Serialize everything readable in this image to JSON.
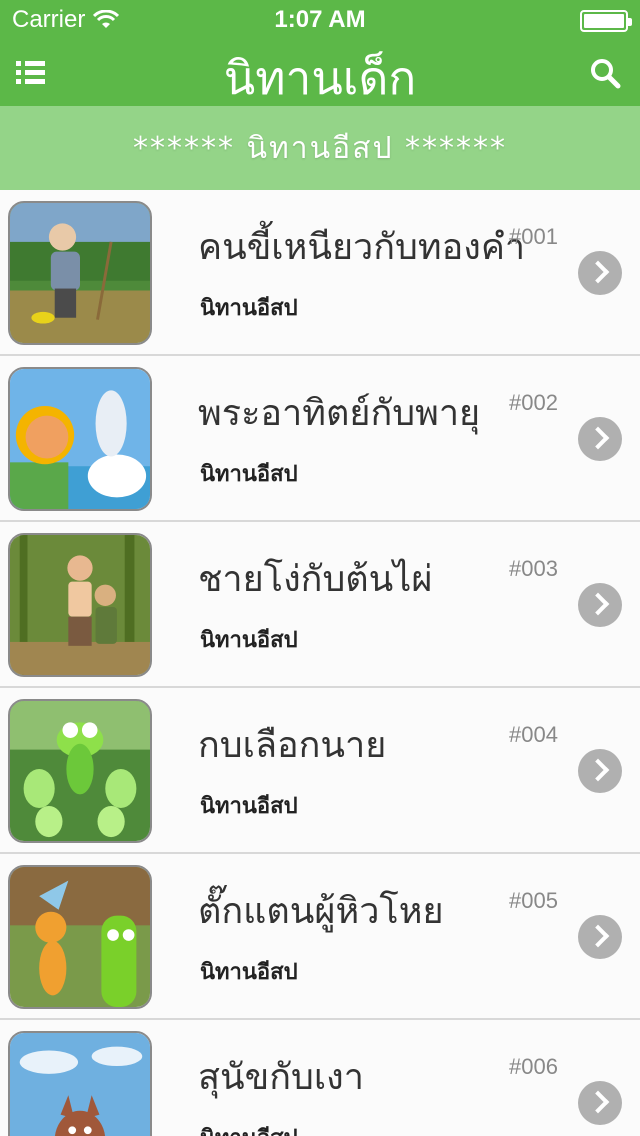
{
  "status_bar": {
    "carrier": "Carrier",
    "time": "1:07 AM"
  },
  "nav": {
    "title": "นิทานเด็ก",
    "menu_icon": "list-icon",
    "search_icon": "search-icon",
    "color": "#5cb848"
  },
  "section": {
    "header": "******   นิทานอีสป   ******",
    "color": "#94d488"
  },
  "items": [
    {
      "title": "คนขี้เหนียวกับทองคำ",
      "number": "#001",
      "category": "นิทานอีสป"
    },
    {
      "title": "พระอาทิตย์กับพายุ",
      "number": "#002",
      "category": "นิทานอีสป"
    },
    {
      "title": "ชายโง่กับต้นไผ่",
      "number": "#003",
      "category": "นิทานอีสป"
    },
    {
      "title": "กบเลือกนาย",
      "number": "#004",
      "category": "นิทานอีสป"
    },
    {
      "title": "ตั๊กแตนผู้หิวโหย",
      "number": "#005",
      "category": "นิทานอีสป"
    },
    {
      "title": "สุนัขกับเงา",
      "number": "#006",
      "category": "นิทานอีสป"
    }
  ]
}
